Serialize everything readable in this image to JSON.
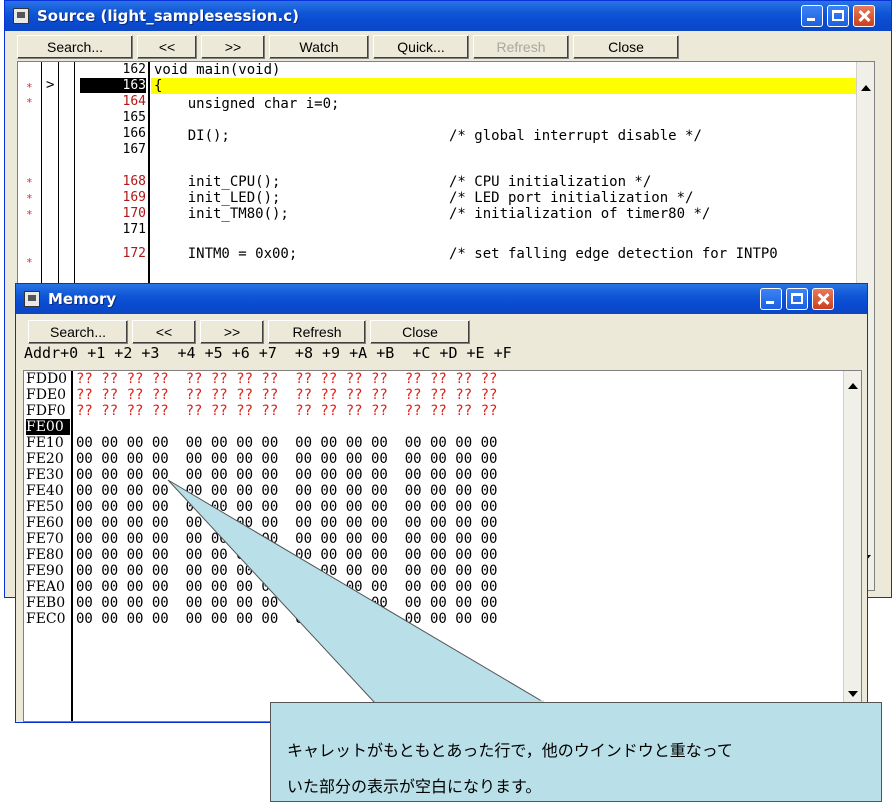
{
  "source_window": {
    "title": "Source (light_samplesession.c)",
    "toolbar": [
      "Search...",
      "<<",
      ">>",
      "Watch",
      "Quick...",
      "Refresh",
      "Close"
    ],
    "disabled_button": "Refresh",
    "current_marker": ">",
    "marker_symbol": "*",
    "lines": [
      {
        "num": "162",
        "code": "void main(void)"
      },
      {
        "num": "163",
        "code": "{"
      },
      {
        "num": "164",
        "code": "    unsigned char i=0;"
      },
      {
        "num": "165",
        "code": ""
      },
      {
        "num": "166",
        "code": "    DI();                          /* global interrupt disable */"
      },
      {
        "num": "167",
        "code": ""
      },
      {
        "num": "168",
        "code": "    init_CPU();                    /* CPU initialization */"
      },
      {
        "num": "169",
        "code": "    init_LED();                    /* LED port initialization */"
      },
      {
        "num": "170",
        "code": "    init_TM80();                   /* initialization of timer80 */"
      },
      {
        "num": "171",
        "code": ""
      },
      {
        "num": "172",
        "code": "    INTM0 = 0x00;                  /* set falling edge detection for INTP0"
      }
    ],
    "highlight_color": "#ffff00"
  },
  "memory_window": {
    "title": "Memory",
    "toolbar": [
      "Search...",
      "<<",
      ">>",
      "Refresh",
      "Close"
    ],
    "header": "Addr+0 +1 +2 +3  +4 +5 +6 +7  +8 +9 +A +B  +C +D +E +F",
    "rows": [
      {
        "addr": "FDD0",
        "vals": "?? ?? ?? ??  ?? ?? ?? ??  ?? ?? ?? ??  ?? ?? ?? ??",
        "unknown": true
      },
      {
        "addr": "FDE0",
        "vals": "?? ?? ?? ??  ?? ?? ?? ??  ?? ?? ?? ??  ?? ?? ?? ??",
        "unknown": true
      },
      {
        "addr": "FDF0",
        "vals": "?? ?? ?? ??  ?? ?? ?? ??  ?? ?? ?? ??  ?? ?? ?? ??",
        "unknown": true
      },
      {
        "addr": "FE00",
        "vals": "",
        "unknown": false,
        "selected": true
      },
      {
        "addr": "FE10",
        "vals": "00 00 00 00  00 00 00 00  00 00 00 00  00 00 00 00",
        "unknown": false
      },
      {
        "addr": "FE20",
        "vals": "00 00 00 00  00 00 00 00  00 00 00 00  00 00 00 00",
        "unknown": false
      },
      {
        "addr": "FE30",
        "vals": "00 00 00 00  00 00 00 00  00 00 00 00  00 00 00 00",
        "unknown": false
      },
      {
        "addr": "FE40",
        "vals": "00 00 00 00  00 00 00 00  00 00 00 00  00 00 00 00",
        "unknown": false
      },
      {
        "addr": "FE50",
        "vals": "00 00 00 00  00 00 00 00  00 00 00 00  00 00 00 00",
        "unknown": false
      },
      {
        "addr": "FE60",
        "vals": "00 00 00 00  00 00 00 00  00 00 00 00  00 00 00 00",
        "unknown": false
      },
      {
        "addr": "FE70",
        "vals": "00 00 00 00  00 00 00 00  00 00 00 00  00 00 00 00",
        "unknown": false
      },
      {
        "addr": "FE80",
        "vals": "00 00 00 00  00 00 00 00  00 00 00 00  00 00 00 00",
        "unknown": false
      },
      {
        "addr": "FE90",
        "vals": "00 00 00 00  00 00 00 00  00 00 00 00  00 00 00 00",
        "unknown": false
      },
      {
        "addr": "FEA0",
        "vals": "00 00 00 00  00 00 00 00  00 00 00 00  00 00 00 00",
        "unknown": false
      },
      {
        "addr": "FEB0",
        "vals": "00 00 00 00  00 00 00 00  00 00 00 00  00 00 00 00",
        "unknown": false
      },
      {
        "addr": "FEC0",
        "vals": "00 00 00 00  00 00 00 00  00 00 00 00  00 00 00 00",
        "unknown": false
      }
    ],
    "unknown_color": "#e0201a"
  },
  "callout": {
    "line1": "キャレットがもともとあった行で，他のウインドウと重なって",
    "line2": "いた部分の表示が空白になります。"
  }
}
